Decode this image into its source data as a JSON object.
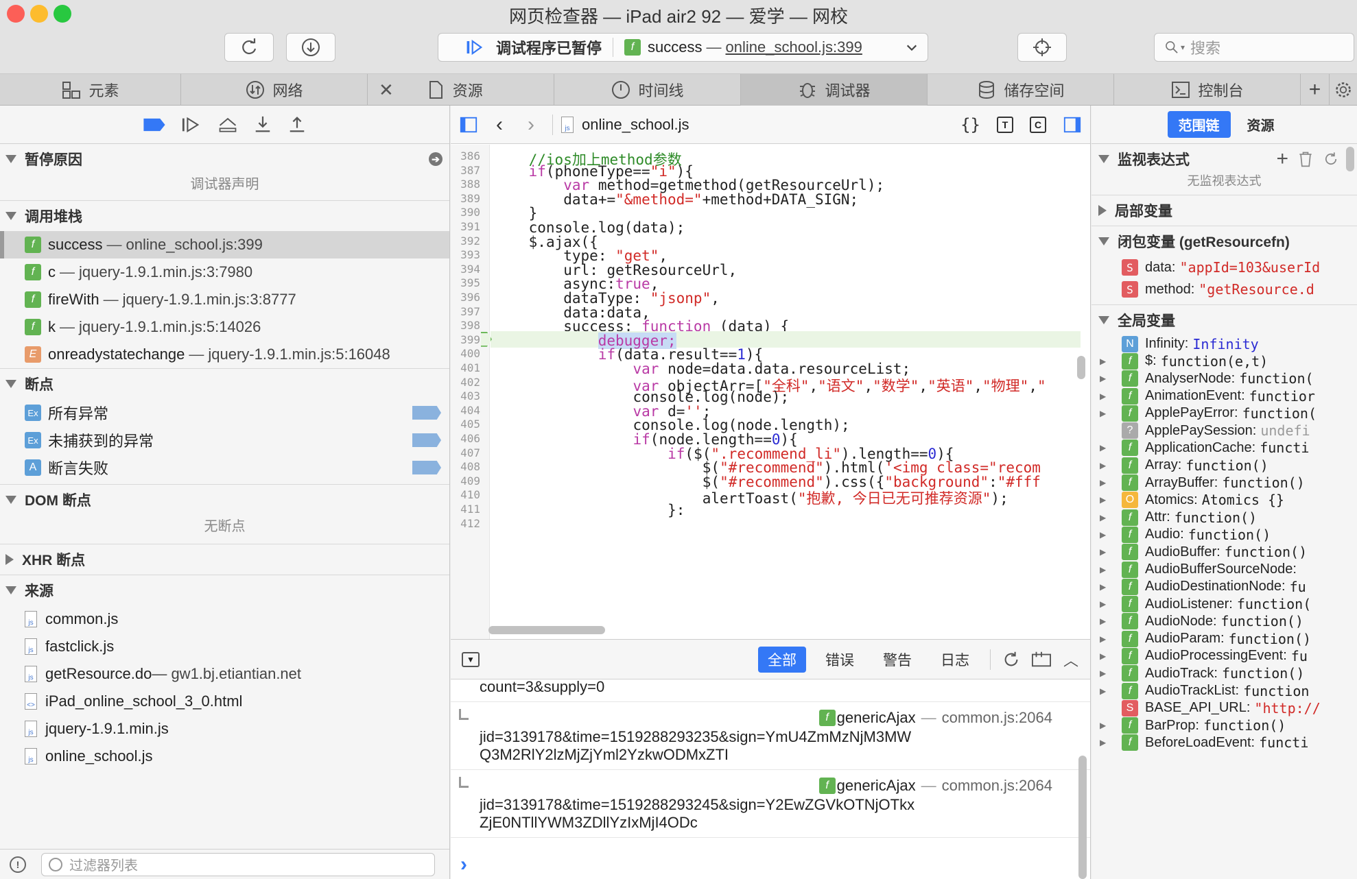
{
  "window": {
    "title": "网页检查器 — iPad air2 92 — 爱学 — 网校"
  },
  "toolbar": {
    "status_paused": "调试程序已暂停",
    "status_func": "success",
    "status_sep": "—",
    "status_loc": "online_school.js:399",
    "search_placeholder": "搜索"
  },
  "tabs": [
    {
      "label": "元素",
      "icon": "elements-icon"
    },
    {
      "label": "网络",
      "icon": "network-icon"
    },
    {
      "label": "资源",
      "icon": "resources-icon"
    },
    {
      "label": "时间线",
      "icon": "timeline-icon"
    },
    {
      "label": "调试器",
      "icon": "debugger-icon"
    },
    {
      "label": "储存空间",
      "icon": "storage-icon"
    },
    {
      "label": "控制台",
      "icon": "console-icon"
    }
  ],
  "left": {
    "pause_reason": {
      "title": "暂停原因",
      "text": "调试器声明"
    },
    "callstack": {
      "title": "调用堆栈",
      "items": [
        {
          "badge": "f",
          "name": "success",
          "sep": "—",
          "loc": "online_school.js:399"
        },
        {
          "badge": "f",
          "name": "c",
          "sep": "—",
          "loc": "jquery-1.9.1.min.js:3:7980"
        },
        {
          "badge": "f",
          "name": "fireWith",
          "sep": "—",
          "loc": "jquery-1.9.1.min.js:3:8777"
        },
        {
          "badge": "f",
          "name": "k",
          "sep": "—",
          "loc": "jquery-1.9.1.min.js:5:14026"
        },
        {
          "badge": "E",
          "name": "onreadystatechange",
          "sep": "—",
          "loc": "jquery-1.9.1.min.js:5:16048"
        }
      ]
    },
    "breakpoints": {
      "title": "断点",
      "items": [
        {
          "badge": "Ex",
          "label": "所有异常"
        },
        {
          "badge": "Ex",
          "label": "未捕获到的异常"
        },
        {
          "badge": "A",
          "label": "断言失败"
        }
      ]
    },
    "dom_bp": {
      "title": "DOM 断点",
      "text": "无断点"
    },
    "xhr_bp": {
      "title": "XHR 断点"
    },
    "sources": {
      "title": "来源",
      "items": [
        {
          "icon": "js",
          "label": "common.js",
          "extra": ""
        },
        {
          "icon": "js",
          "label": "fastclick.js",
          "extra": ""
        },
        {
          "icon": "js",
          "label": "getResource.do",
          "extra": " — gw1.bj.etiantian.net"
        },
        {
          "icon": "html",
          "label": "iPad_online_school_3_0.html",
          "extra": ""
        },
        {
          "icon": "js",
          "label": "jquery-1.9.1.min.js",
          "extra": ""
        },
        {
          "icon": "js",
          "label": "online_school.js",
          "extra": ""
        }
      ]
    },
    "filter_placeholder": "过滤器列表"
  },
  "editor": {
    "filename": "online_school.js",
    "lines": [
      {
        "n": "386",
        "code": "    //ios加上method参数"
      },
      {
        "n": "387",
        "code": "    if(phoneType==\"i\"){"
      },
      {
        "n": "388",
        "code": "        var method=getmethod(getResourceUrl);"
      },
      {
        "n": "389",
        "code": "        data+=\"&method=\"+method+DATA_SIGN;"
      },
      {
        "n": "390",
        "code": "    }"
      },
      {
        "n": "391",
        "code": "    console.log(data);"
      },
      {
        "n": "392",
        "code": "    $.ajax({"
      },
      {
        "n": "393",
        "code": "        type: \"get\","
      },
      {
        "n": "394",
        "code": "        url: getResourceUrl,"
      },
      {
        "n": "395",
        "code": "        async:true,"
      },
      {
        "n": "396",
        "code": "        dataType: \"jsonp\","
      },
      {
        "n": "397",
        "code": "        data:data,"
      },
      {
        "n": "398",
        "code": "        success: function (data) {"
      },
      {
        "n": "399",
        "code": "            debugger;"
      },
      {
        "n": "400",
        "code": "            if(data.result==1){"
      },
      {
        "n": "401",
        "code": "                var node=data.data.resourceList;"
      },
      {
        "n": "402",
        "code": "                var objectArr=[\"全科\",\"语文\",\"数学\",\"英语\",\"物理\",\""
      },
      {
        "n": "403",
        "code": "                console.log(node);"
      },
      {
        "n": "404",
        "code": "                var d='';"
      },
      {
        "n": "405",
        "code": "                console.log(node.length);"
      },
      {
        "n": "406",
        "code": "                if(node.length==0){"
      },
      {
        "n": "407",
        "code": "                    if($(\".recommend_li\").length==0){"
      },
      {
        "n": "408",
        "code": "                        $(\"#recommend\").html('<img class=\"recom"
      },
      {
        "n": "409",
        "code": "                        $(\"#recommend\").css({\"background\":\"#fff"
      },
      {
        "n": "410",
        "code": "                        alertToast(\"抱歉, 今日已无可推荐资源\");"
      },
      {
        "n": "411",
        "code": "                    }:"
      },
      {
        "n": "412",
        "code": ""
      }
    ]
  },
  "console": {
    "filters": [
      "全部",
      "错误",
      "警告",
      "日志"
    ],
    "lead": "count=3&supply=0",
    "entries": [
      {
        "func": "genericAjax",
        "sep": "—",
        "loc": "common.js:2064",
        "text": "jid=3139178&time=1519288293235&sign=YmU4ZmMzNjM3MWQ3M2RlY2lzMjZjYml2YzkwODMxZTI"
      },
      {
        "func": "genericAjax",
        "sep": "—",
        "loc": "common.js:2064",
        "text": "jid=3139178&time=1519288293245&sign=Y2EwZGVkOTNjOTkxZjE0NTllYWM3ZDllYzIxMjI4ODc"
      }
    ],
    "prompt": "›"
  },
  "right": {
    "tabs": [
      "范围链",
      "资源"
    ],
    "watch": {
      "title": "监视表达式",
      "text": "无监视表达式"
    },
    "locals": {
      "title": "局部变量"
    },
    "closure": {
      "title": "闭包变量 (getResourcefn)",
      "items": [
        {
          "badge": "S",
          "key": "data:",
          "val": "\"appId=103&userId"
        },
        {
          "badge": "S",
          "key": "method:",
          "val": "\"getResource.d"
        }
      ]
    },
    "globals": {
      "title": "全局变量",
      "items": [
        {
          "badge": "N",
          "key": "Infinity:",
          "val": "Infinity",
          "exp": false
        },
        {
          "badge": "f",
          "key": "$:",
          "val": "function(e,t)",
          "exp": true
        },
        {
          "badge": "f",
          "key": "AnalyserNode:",
          "val": "function(",
          "exp": true
        },
        {
          "badge": "f",
          "key": "AnimationEvent:",
          "val": "functior",
          "exp": true
        },
        {
          "badge": "f",
          "key": "ApplePayError:",
          "val": "function(",
          "exp": true
        },
        {
          "badge": "?",
          "key": "ApplePaySession:",
          "val": "undefi",
          "exp": false
        },
        {
          "badge": "f",
          "key": "ApplicationCache:",
          "val": "functi",
          "exp": true
        },
        {
          "badge": "f",
          "key": "Array:",
          "val": "function()",
          "exp": true
        },
        {
          "badge": "f",
          "key": "ArrayBuffer:",
          "val": "function()",
          "exp": true
        },
        {
          "badge": "O",
          "key": "Atomics:",
          "val": "Atomics {}",
          "exp": true
        },
        {
          "badge": "f",
          "key": "Attr:",
          "val": "function()",
          "exp": true
        },
        {
          "badge": "f",
          "key": "Audio:",
          "val": "function()",
          "exp": true
        },
        {
          "badge": "f",
          "key": "AudioBuffer:",
          "val": "function()",
          "exp": true
        },
        {
          "badge": "f",
          "key": "AudioBufferSourceNode:",
          "val": "",
          "exp": true
        },
        {
          "badge": "f",
          "key": "AudioDestinationNode:",
          "val": "fu",
          "exp": true
        },
        {
          "badge": "f",
          "key": "AudioListener:",
          "val": "function(",
          "exp": true
        },
        {
          "badge": "f",
          "key": "AudioNode:",
          "val": "function()",
          "exp": true
        },
        {
          "badge": "f",
          "key": "AudioParam:",
          "val": "function()",
          "exp": true
        },
        {
          "badge": "f",
          "key": "AudioProcessingEvent:",
          "val": "fu",
          "exp": true
        },
        {
          "badge": "f",
          "key": "AudioTrack:",
          "val": "function()",
          "exp": true
        },
        {
          "badge": "f",
          "key": "AudioTrackList:",
          "val": "function",
          "exp": true
        },
        {
          "badge": "S",
          "key": "BASE_API_URL:",
          "val": "\"http://",
          "exp": false
        },
        {
          "badge": "f",
          "key": "BarProp:",
          "val": "function()",
          "exp": true
        },
        {
          "badge": "f",
          "key": "BeforeLoadEvent:",
          "val": "functi",
          "exp": true
        }
      ]
    }
  },
  "colors": {
    "accent": "#3478f6",
    "keyword": "#b93aa5",
    "string": "#d12a27",
    "number": "#2b2bd3",
    "comment": "#2e8b28",
    "fbadge": "#62b352",
    "sbadge": "#e25c60"
  }
}
